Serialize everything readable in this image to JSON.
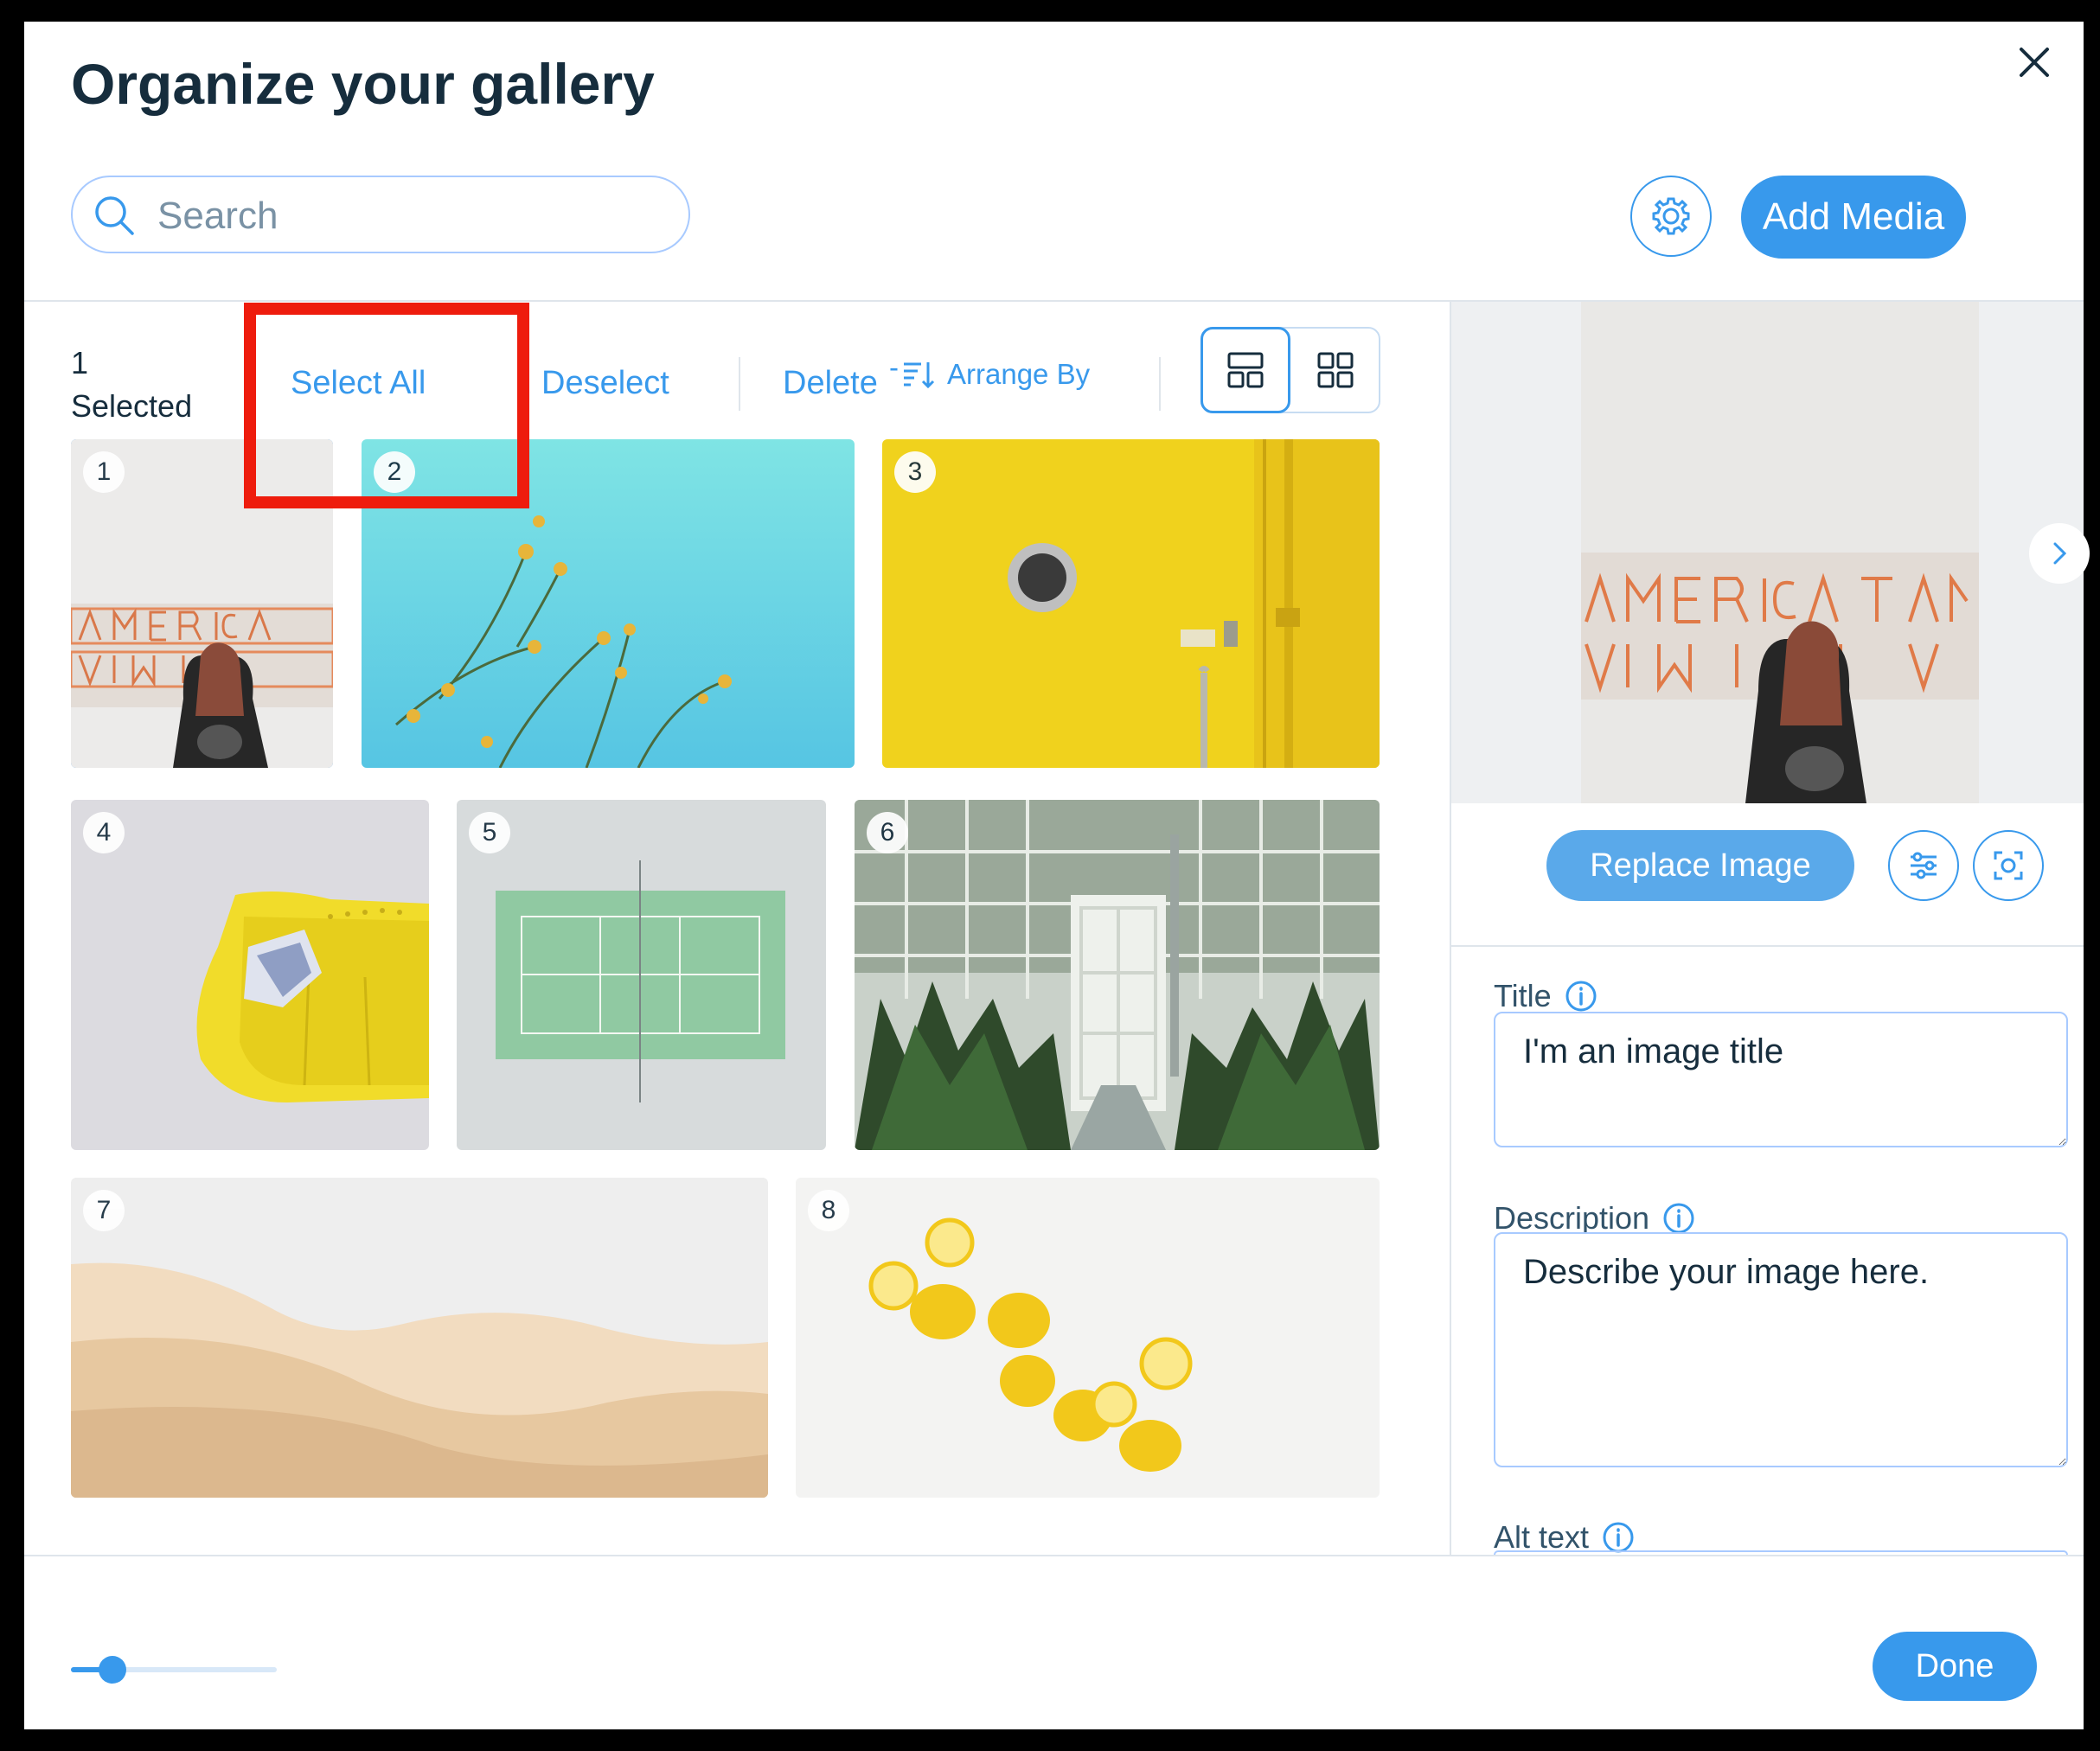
{
  "dialog": {
    "title": "Organize your gallery",
    "search": {
      "placeholder": "Search"
    },
    "add_media_label": "Add Media",
    "done_label": "Done"
  },
  "toolbar": {
    "selected_count": "1",
    "selected_label": "Selected",
    "select_all_label": "Select All",
    "deselect_label": "Deselect",
    "delete_label": "Delete",
    "arrange_by_label": "Arrange By",
    "arrange_prefix": "-"
  },
  "gallery": {
    "items": [
      {
        "number": "1",
        "subject": "America neon sign",
        "selected": true
      },
      {
        "number": "2",
        "subject": "flowers against sky",
        "selected": false
      },
      {
        "number": "3",
        "subject": "yellow door",
        "selected": false
      },
      {
        "number": "4",
        "subject": "yellow sofa",
        "selected": false
      },
      {
        "number": "5",
        "subject": "tennis court",
        "selected": false
      },
      {
        "number": "6",
        "subject": "greenhouse",
        "selected": false
      },
      {
        "number": "7",
        "subject": "desert dunes",
        "selected": false
      },
      {
        "number": "8",
        "subject": "lemons",
        "selected": false
      }
    ]
  },
  "details": {
    "preview_subject": "America neon sign",
    "replace_image_label": "Replace Image",
    "title_label": "Title",
    "title_value": "I'm an image title",
    "description_label": "Description",
    "description_value": "Describe your image here.",
    "alt_text_label": "Alt text"
  },
  "zoom": {
    "level": 0.2
  },
  "colors": {
    "accent": "#3899ec",
    "highlight": "#ee1c0d",
    "title": "#162d3d"
  },
  "icons": [
    "close-icon",
    "search-icon",
    "gear-icon",
    "sort-icon",
    "masonry-layout-icon",
    "grid-layout-icon",
    "chevron-right-icon",
    "sliders-icon",
    "focal-point-icon",
    "info-icon"
  ]
}
